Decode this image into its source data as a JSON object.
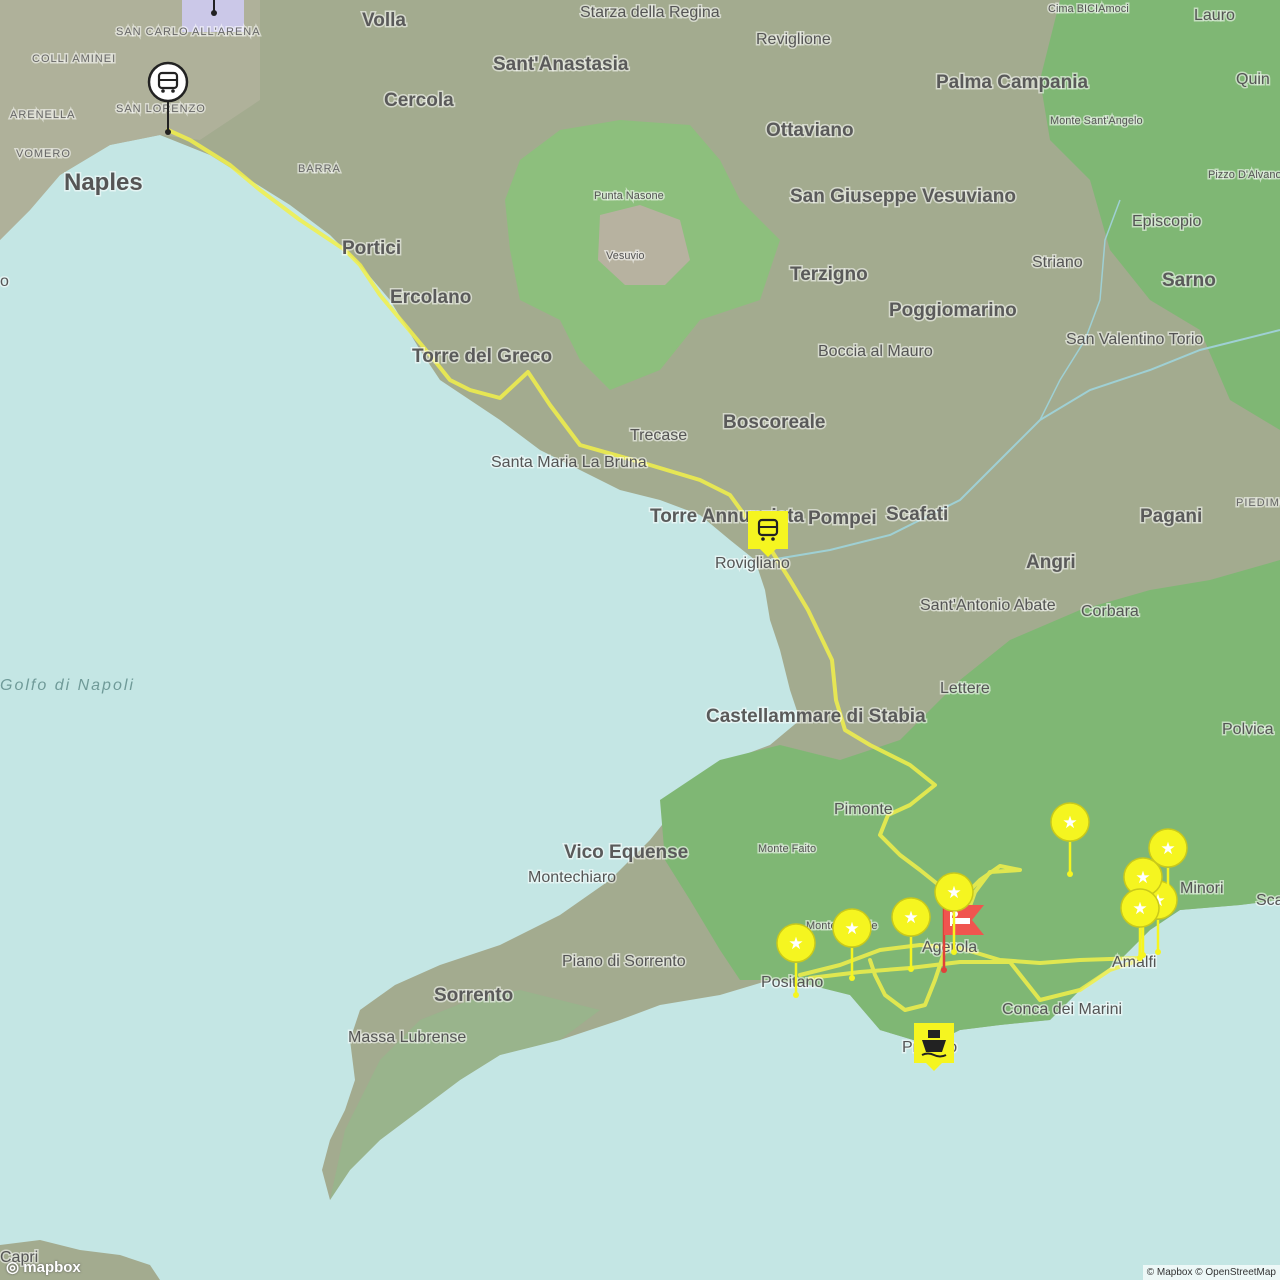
{
  "map": {
    "labels": {
      "naples": "Naples",
      "volla": "Volla",
      "starza": "Starza della Regina",
      "reviglione": "Reviglione",
      "cima_bici": "Cima BICIAmoci",
      "lauro": "Lauro",
      "quin": "Quin",
      "san_carlo": "SAN CARLO ALL'ARENA",
      "colli_aminei": "COLLI AMINEI",
      "arenella": "ARENELLA",
      "san_lorenzo": "SAN LORENZO",
      "vomero": "VOMERO",
      "barra": "BARRA",
      "sant_anastasia": "Sant'Anastasia",
      "cercola": "Cercola",
      "palma": "Palma Campania",
      "monte_santangelo": "Monte Sant'Angelo",
      "ottaviano": "Ottaviano",
      "pizzo_dalvano": "Pizzo D'Alvano",
      "punta_nasone": "Punta Nasone",
      "vesuvio": "Vesuvio",
      "san_giuseppe": "San Giuseppe Vesuviano",
      "episcopio": "Episcopio",
      "portici": "Portici",
      "ercolano": "Ercolano",
      "striano": "Striano",
      "terzigno": "Terzigno",
      "sarno": "Sarno",
      "poggiomarino": "Poggiomarino",
      "san_valentino": "San Valentino Torio",
      "torre_greco": "Torre del Greco",
      "boccia": "Boccia al Mauro",
      "boscoreale": "Boscoreale",
      "trecase": "Trecase",
      "santa_maria": "Santa Maria La Bruna",
      "torre_annunziata": "Torre Annunziata",
      "pompei": "Pompei",
      "scafati": "Scafati",
      "pagani": "Pagani",
      "piedimonte": "PIEDIMO",
      "rovigliano": "Rovigliano",
      "angri": "Angri",
      "santantonio": "Sant'Antonio Abate",
      "corbara": "Corbara",
      "golfo": "Golfo di Napoli",
      "lettere": "Lettere",
      "polvica": "Polvica",
      "castellammare": "Castellammare di Stabia",
      "pimonte": "Pimonte",
      "vico": "Vico Equense",
      "monte_faito": "Monte Faito",
      "montechiaro": "Montechiaro",
      "minori": "Minori",
      "scala": "Sca",
      "agerola": "Agerola",
      "amalfi": "Amalfi",
      "piano": "Piano di Sorrento",
      "positano": "Positano",
      "monte_michele": "Monte Michele",
      "sorrento": "Sorrento",
      "conca": "Conca dei Marini",
      "praiano": "Praiano",
      "massa": "Massa Lubrense",
      "capri": "Capri",
      "edge_o": "o"
    },
    "attribution": "© Mapbox © OpenStreetMap",
    "logo_text": "mapbox",
    "colors": {
      "sea": "#c4e6e4",
      "land": "#a3ab8f",
      "forest": "#7fb774",
      "route": "#f2f04a",
      "marker": "#f5f520",
      "lodging": "#f0554f",
      "start": "#222222"
    },
    "markers": {
      "start": "bus-icon",
      "bus_stop": "bus-icon",
      "ferry": "ferry-icon",
      "lodging": "bed-icon",
      "poi": "star-icon"
    }
  }
}
